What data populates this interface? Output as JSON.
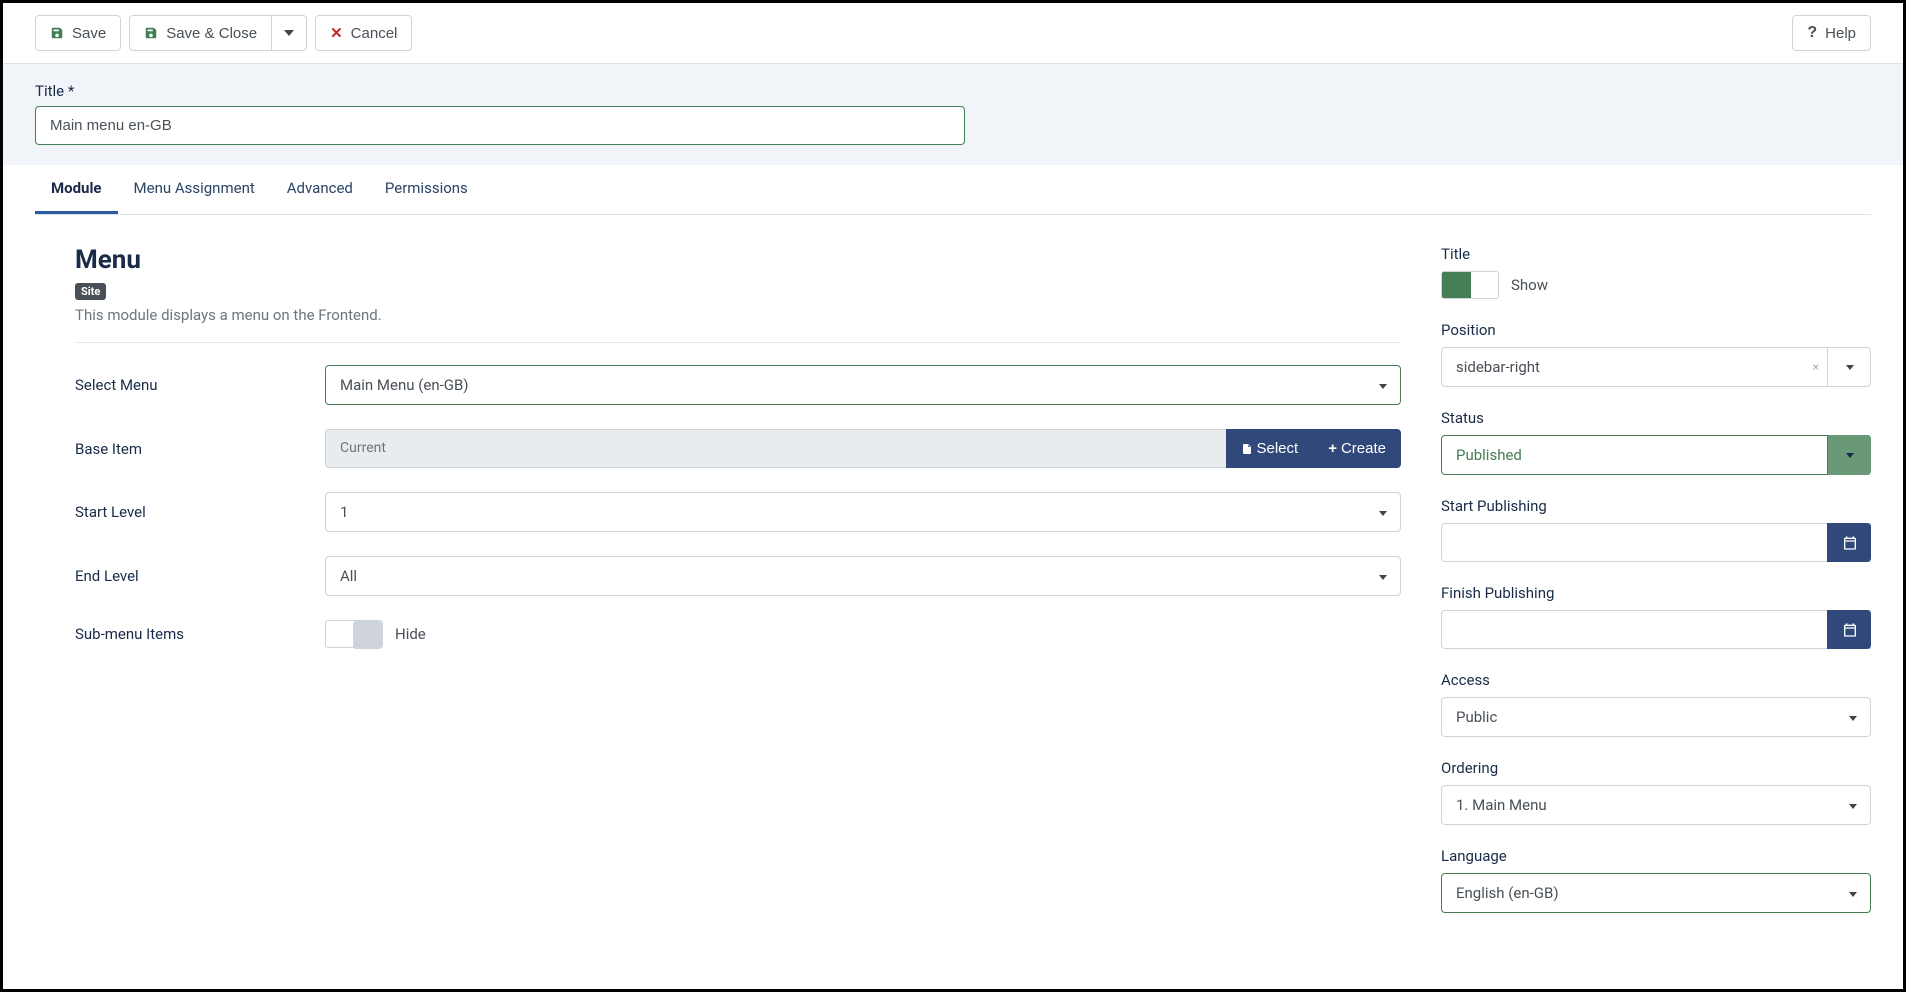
{
  "toolbar": {
    "save": "Save",
    "save_close": "Save & Close",
    "cancel": "Cancel",
    "help": "Help"
  },
  "title_block": {
    "label": "Title *",
    "value": "Main menu en-GB"
  },
  "tabs": {
    "module": "Module",
    "menu_assignment": "Menu Assignment",
    "advanced": "Advanced",
    "permissions": "Permissions"
  },
  "main": {
    "heading": "Menu",
    "badge": "Site",
    "description": "This module displays a menu on the Frontend.",
    "select_menu_label": "Select Menu",
    "select_menu_value": "Main Menu (en-GB)",
    "base_item_label": "Base Item",
    "base_item_value": "Current",
    "base_item_select": "Select",
    "base_item_create": "Create",
    "start_level_label": "Start Level",
    "start_level_value": "1",
    "end_level_label": "End Level",
    "end_level_value": "All",
    "submenu_label": "Sub-menu Items",
    "submenu_value": "Hide"
  },
  "side": {
    "title_label": "Title",
    "title_value": "Show",
    "position_label": "Position",
    "position_value": "sidebar-right",
    "status_label": "Status",
    "status_value": "Published",
    "start_pub_label": "Start Publishing",
    "start_pub_value": "",
    "finish_pub_label": "Finish Publishing",
    "finish_pub_value": "",
    "access_label": "Access",
    "access_value": "Public",
    "ordering_label": "Ordering",
    "ordering_value": "1. Main Menu",
    "language_label": "Language",
    "language_value": "English (en-GB)"
  }
}
